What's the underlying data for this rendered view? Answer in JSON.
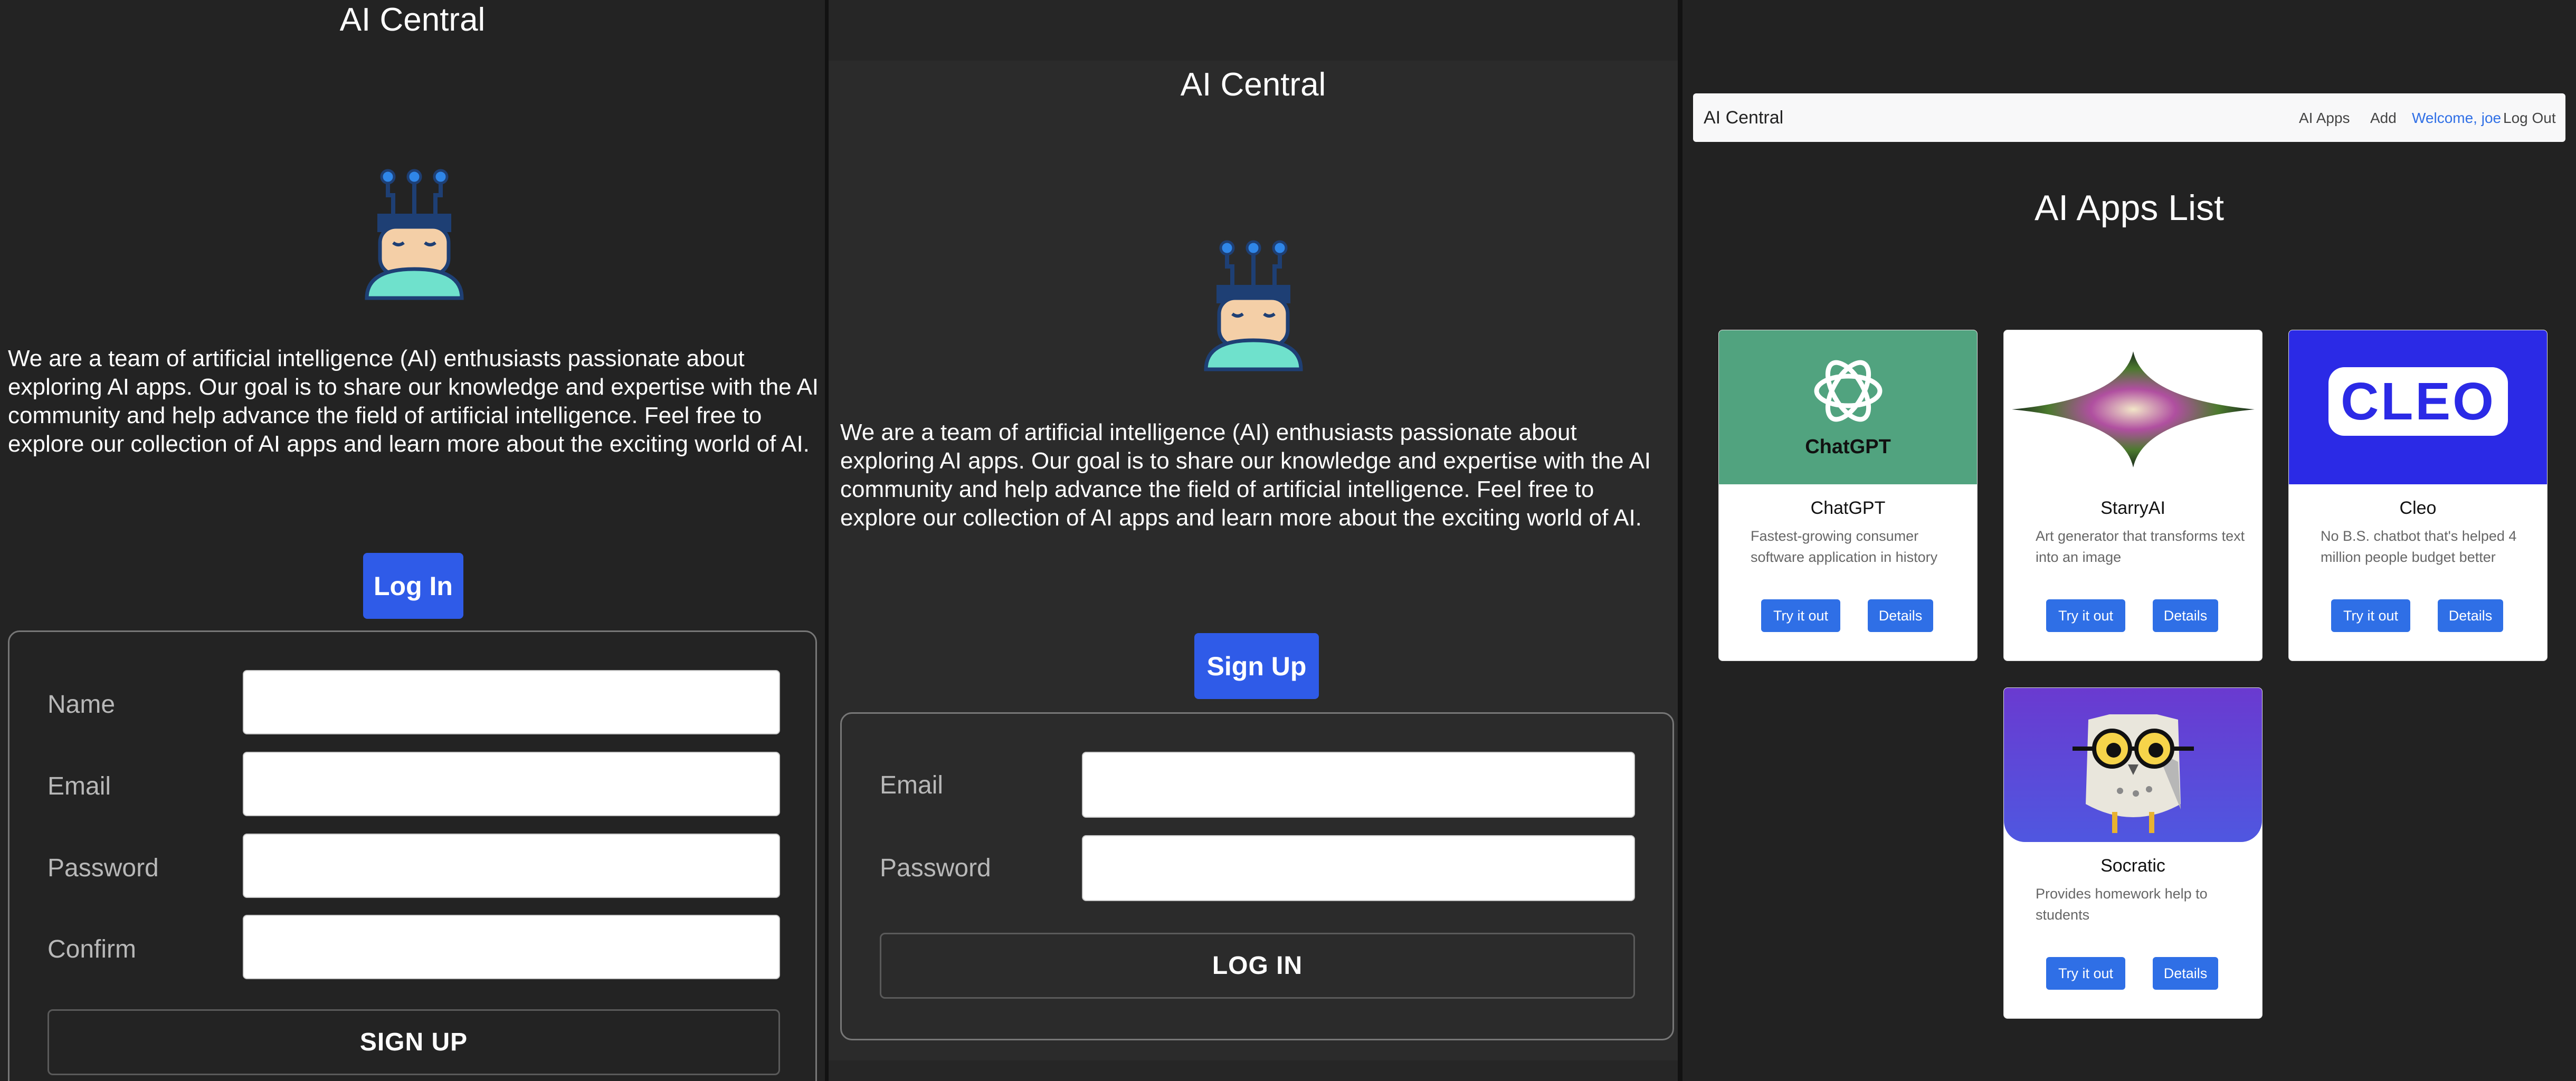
{
  "signup_panel": {
    "title": "AI Central",
    "about": "We are a team of artificial intelligence (AI) enthusiasts passionate about exploring AI apps. Our goal is to share our knowledge and expertise with the AI community and help advance the field of artificial intelligence. Feel free to explore our collection of AI apps and learn more about the exciting world of AI.",
    "toggle_button": "Log In",
    "fields": [
      {
        "label": "Name",
        "value": ""
      },
      {
        "label": "Email",
        "value": ""
      },
      {
        "label": "Password",
        "value": ""
      },
      {
        "label": "Confirm",
        "value": ""
      }
    ],
    "submit_label": "SIGN UP"
  },
  "login_panel": {
    "title": "AI Central",
    "about": "We are a team of artificial intelligence (AI) enthusiasts passionate about exploring AI apps. Our goal is to share our knowledge and expertise with the AI community and help advance the field of artificial intelligence. Feel free to explore our collection of AI apps and learn more about the exciting world of AI.",
    "toggle_button": "Sign Up",
    "fields": [
      {
        "label": "Email",
        "value": ""
      },
      {
        "label": "Password",
        "value": ""
      }
    ],
    "submit_label": "LOG IN"
  },
  "apps_panel": {
    "navbar": {
      "brand": "AI Central",
      "links": [
        "AI Apps",
        "Add"
      ],
      "welcome": "Welcome, joe",
      "logout": "Log Out"
    },
    "heading": "AI Apps List",
    "cards": [
      {
        "name": "ChatGPT",
        "description": "Fastest-growing consumer software application in history",
        "image_label": "ChatGPT",
        "try_label": "Try it out",
        "details_label": "Details"
      },
      {
        "name": "StarryAI",
        "description": "Art generator that transforms text into an image",
        "try_label": "Try it out",
        "details_label": "Details"
      },
      {
        "name": "Cleo",
        "description": "No B.S. chatbot that's helped 4 million people budget better",
        "image_label": "CLEO",
        "try_label": "Try it out",
        "details_label": "Details"
      },
      {
        "name": "Socratic",
        "description": "Provides homework help to students",
        "try_label": "Try it out",
        "details_label": "Details"
      }
    ]
  },
  "colors": {
    "primary_button": "#2f5be8",
    "link_blue": "#2f6fe6",
    "chatgpt_green": "#51a37f",
    "cleo_blue": "#2b2ae6",
    "socratic_purple": "#5a3ed8"
  },
  "icons": [
    "robot-avatar-icon",
    "chatgpt-logo-icon",
    "starryai-star-icon",
    "cleo-logo-icon",
    "socratic-owl-icon"
  ]
}
